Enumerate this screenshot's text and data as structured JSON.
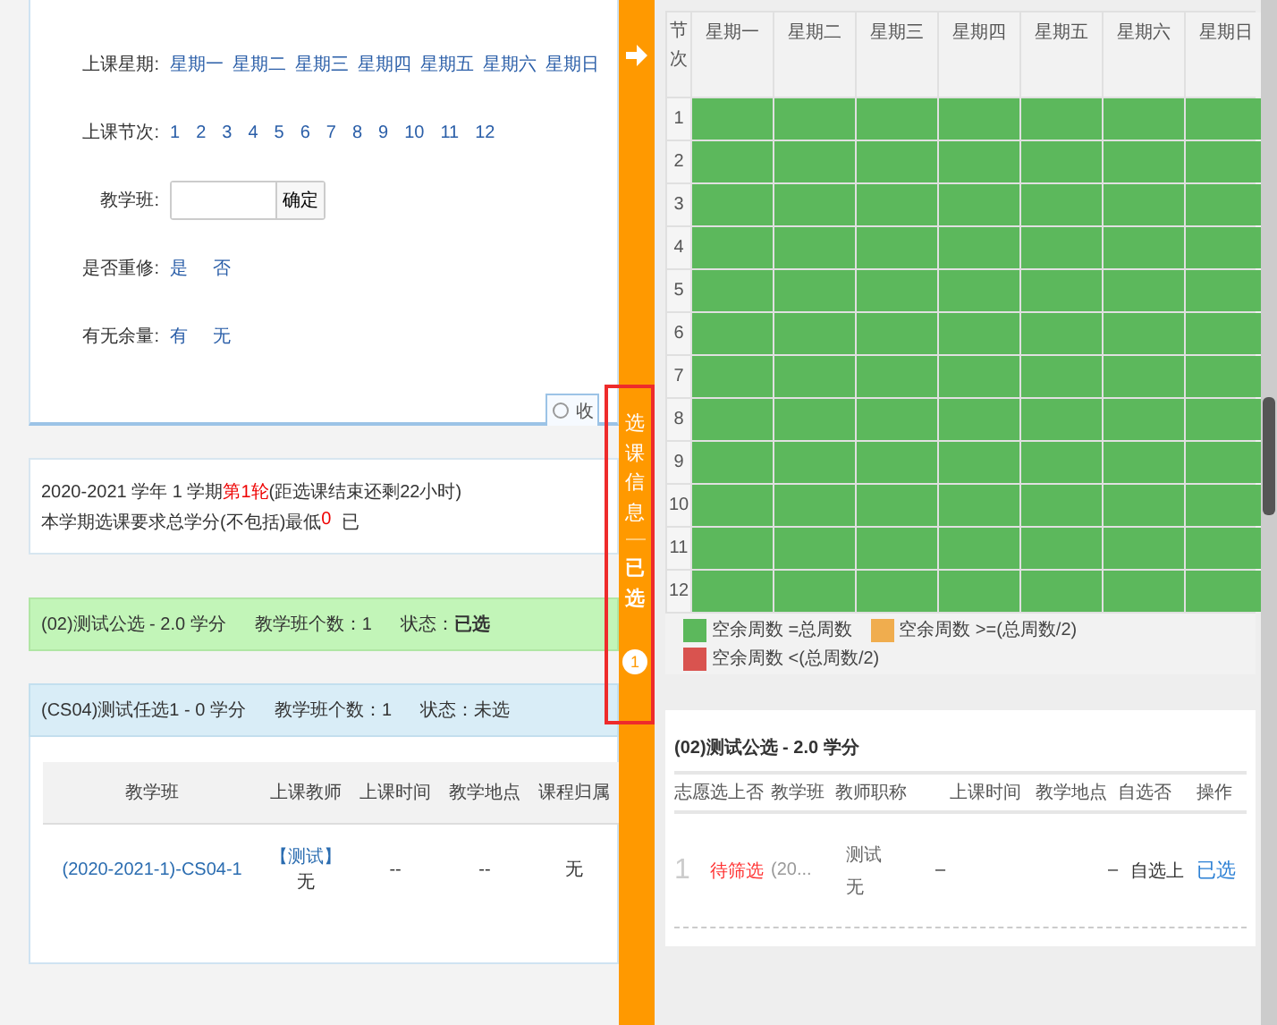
{
  "filter": {
    "rows": [
      {
        "kind": "options",
        "label": "上课星期:",
        "options": [
          "星期一",
          "星期二",
          "星期三",
          "星期四",
          "星期五",
          "星期六",
          "星期日"
        ]
      },
      {
        "kind": "options",
        "label": "上课节次:",
        "options": [
          "1",
          "2",
          "3",
          "4",
          "5",
          "6",
          "7",
          "8",
          "9",
          "10",
          "11",
          "12"
        ]
      },
      {
        "kind": "input",
        "label": "教学班:",
        "button": "确定"
      },
      {
        "kind": "options",
        "label": "是否重修:",
        "options": [
          "是",
          "否"
        ]
      },
      {
        "kind": "options",
        "label": "有无余量:",
        "options": [
          "有",
          "无"
        ]
      }
    ],
    "collapse": "收"
  },
  "info": {
    "term": "2020-2021 学年 1 学期",
    "round": "第1轮",
    "remaining": "(距选课结束还剩22小时)",
    "requirement": "本学期选课要求总学分(不包括)最低",
    "minimum": "0",
    "more": "已"
  },
  "courses": [
    {
      "title": "(02)测试公选 - 2.0 学分",
      "count": "教学班个数：1",
      "status": "状态：**已选**",
      "selected": true,
      "expanded": false
    },
    {
      "title": "(CS04)测试任选1 - 0 学分",
      "count": "教学班个数：1",
      "status": "状态：未选",
      "selected": false,
      "expanded": true
    }
  ],
  "class_table": {
    "columns": [
      "教学班",
      "上课教师",
      "上课时间",
      "教学地点",
      "课程归属"
    ],
    "rows": [
      {
        "class": "(2020-2021-1)-CS04-1",
        "teacher_link": "【测试】",
        "teacher": "无",
        "time": "--",
        "place": "--",
        "belongs": "无"
      }
    ]
  },
  "sidebar": {
    "tab": "选课信息",
    "selected_tab": "已选",
    "badge": "1"
  },
  "timetable": {
    "corner": "节次",
    "days": [
      "星期一",
      "星期二",
      "星期三",
      "星期四",
      "星期五",
      "星期六",
      "星期日"
    ],
    "rows": [
      {
        "label": "1",
        "cells": [
          {
            "color": "#5cb85c"
          },
          {
            "color": "#5cb85c"
          },
          {
            "color": "#5cb85c"
          },
          {
            "color": "#5cb85c"
          },
          {
            "color": "#5cb85c"
          },
          {
            "color": "#5cb85c"
          },
          {
            "color": "#5cb85c"
          }
        ]
      },
      {
        "label": "2",
        "cells": [
          {
            "color": "#5cb85c"
          },
          {
            "color": "#5cb85c"
          },
          {
            "color": "#5cb85c"
          },
          {
            "color": "#5cb85c"
          },
          {
            "color": "#5cb85c"
          },
          {
            "color": "#5cb85c"
          },
          {
            "color": "#5cb85c"
          }
        ]
      },
      {
        "label": "3",
        "cells": [
          {
            "color": "#5cb85c"
          },
          {
            "color": "#5cb85c"
          },
          {
            "color": "#5cb85c"
          },
          {
            "color": "#5cb85c"
          },
          {
            "color": "#5cb85c"
          },
          {
            "color": "#5cb85c"
          },
          {
            "color": "#5cb85c"
          }
        ]
      },
      {
        "label": "4",
        "cells": [
          {
            "color": "#5cb85c"
          },
          {
            "color": "#5cb85c"
          },
          {
            "color": "#5cb85c"
          },
          {
            "color": "#5cb85c"
          },
          {
            "color": "#5cb85c"
          },
          {
            "color": "#5cb85c"
          },
          {
            "color": "#5cb85c"
          }
        ]
      },
      {
        "label": "5",
        "cells": [
          {
            "color": "#5cb85c"
          },
          {
            "color": "#5cb85c"
          },
          {
            "color": "#5cb85c"
          },
          {
            "color": "#5cb85c"
          },
          {
            "color": "#5cb85c"
          },
          {
            "color": "#5cb85c"
          },
          {
            "color": "#5cb85c"
          }
        ]
      },
      {
        "label": "6",
        "cells": [
          {
            "color": "#5cb85c"
          },
          {
            "color": "#5cb85c"
          },
          {
            "color": "#5cb85c"
          },
          {
            "color": "#5cb85c"
          },
          {
            "color": "#5cb85c"
          },
          {
            "color": "#5cb85c"
          },
          {
            "color": "#5cb85c"
          }
        ]
      },
      {
        "label": "7",
        "cells": [
          {
            "color": "#5cb85c"
          },
          {
            "color": "#5cb85c"
          },
          {
            "color": "#5cb85c"
          },
          {
            "color": "#5cb85c"
          },
          {
            "color": "#5cb85c"
          },
          {
            "color": "#5cb85c"
          },
          {
            "color": "#5cb85c"
          }
        ]
      },
      {
        "label": "8",
        "cells": [
          {
            "color": "#5cb85c"
          },
          {
            "color": "#5cb85c"
          },
          {
            "color": "#5cb85c"
          },
          {
            "color": "#5cb85c"
          },
          {
            "color": "#5cb85c"
          },
          {
            "color": "#5cb85c"
          },
          {
            "color": "#5cb85c"
          }
        ]
      },
      {
        "label": "9",
        "cells": [
          {
            "color": "#5cb85c"
          },
          {
            "color": "#5cb85c"
          },
          {
            "color": "#5cb85c"
          },
          {
            "color": "#5cb85c"
          },
          {
            "color": "#5cb85c"
          },
          {
            "color": "#5cb85c"
          },
          {
            "color": "#5cb85c"
          }
        ]
      },
      {
        "label": "10",
        "cells": [
          {
            "color": "#5cb85c"
          },
          {
            "color": "#5cb85c"
          },
          {
            "color": "#5cb85c"
          },
          {
            "color": "#5cb85c"
          },
          {
            "color": "#5cb85c"
          },
          {
            "color": "#5cb85c"
          },
          {
            "color": "#5cb85c"
          }
        ]
      },
      {
        "label": "11",
        "cells": [
          {
            "color": "#5cb85c"
          },
          {
            "color": "#5cb85c"
          },
          {
            "color": "#5cb85c"
          },
          {
            "color": "#5cb85c"
          },
          {
            "color": "#5cb85c"
          },
          {
            "color": "#5cb85c"
          },
          {
            "color": "#5cb85c"
          }
        ]
      },
      {
        "label": "12",
        "cells": [
          {
            "color": "#5cb85c"
          },
          {
            "color": "#5cb85c"
          },
          {
            "color": "#5cb85c"
          },
          {
            "color": "#5cb85c"
          },
          {
            "color": "#5cb85c"
          },
          {
            "color": "#5cb85c"
          },
          {
            "color": "#5cb85c"
          }
        ]
      }
    ],
    "legend": [
      {
        "color": "#5cb85c",
        "label": "空余周数 =总周数"
      },
      {
        "color": "#f0ad4e",
        "label": "空余周数 >=(总周数/2)"
      },
      {
        "color": "#d9534f",
        "label": "空余周数 <(总周数/2)"
      }
    ]
  },
  "chosen": {
    "title": "(02)测试公选 - 2.0 学分",
    "columns": [
      "志愿",
      "选上否",
      "教学班",
      "教师职称",
      "上课时间",
      "教学地点",
      "自选否",
      "操作"
    ],
    "rows": [
      {
        "priority": "1",
        "status": "待筛选",
        "class": "(20...",
        "teacher": "测试",
        "title": "无",
        "time": "–",
        "place": "–",
        "self": "自选上",
        "action": "已选"
      }
    ]
  }
}
